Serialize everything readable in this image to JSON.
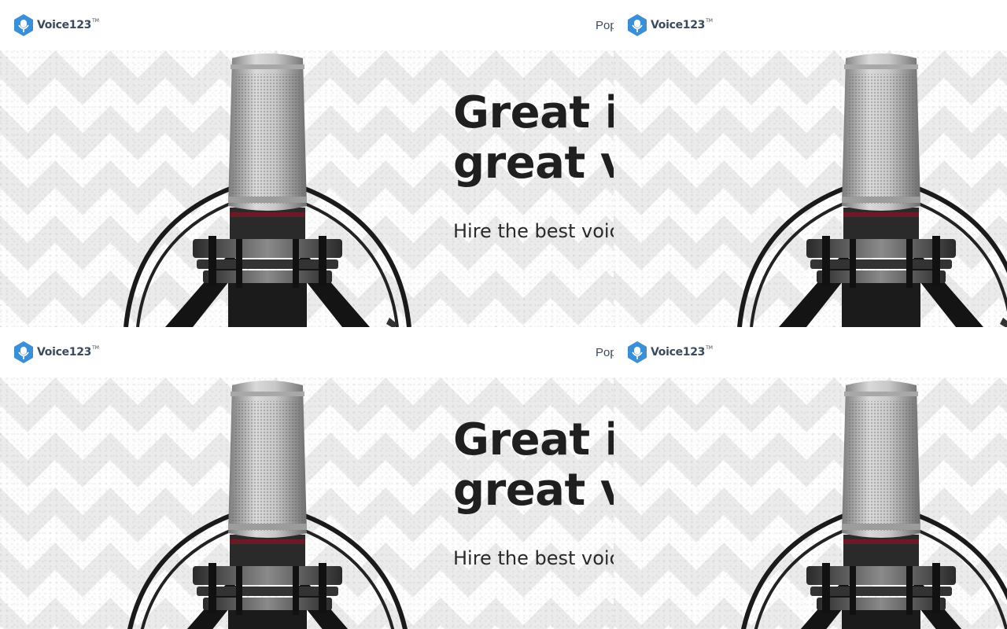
{
  "brand": {
    "name": "Voice123",
    "trademark": "TM",
    "color": "#3a8fd6"
  },
  "nav": {
    "partial_item": "Pop"
  },
  "hero": {
    "headline_line1": "Great ic",
    "headline_line2": "great vo",
    "subline": "Hire the best voice"
  },
  "colors": {
    "text_dark": "#1f1f1f",
    "logo_text": "#3b4a5c",
    "hero_bg": "#f3f3f3"
  },
  "icons": {
    "logo": "microphone-hexagon-icon",
    "hero_image": "studio-microphone"
  }
}
